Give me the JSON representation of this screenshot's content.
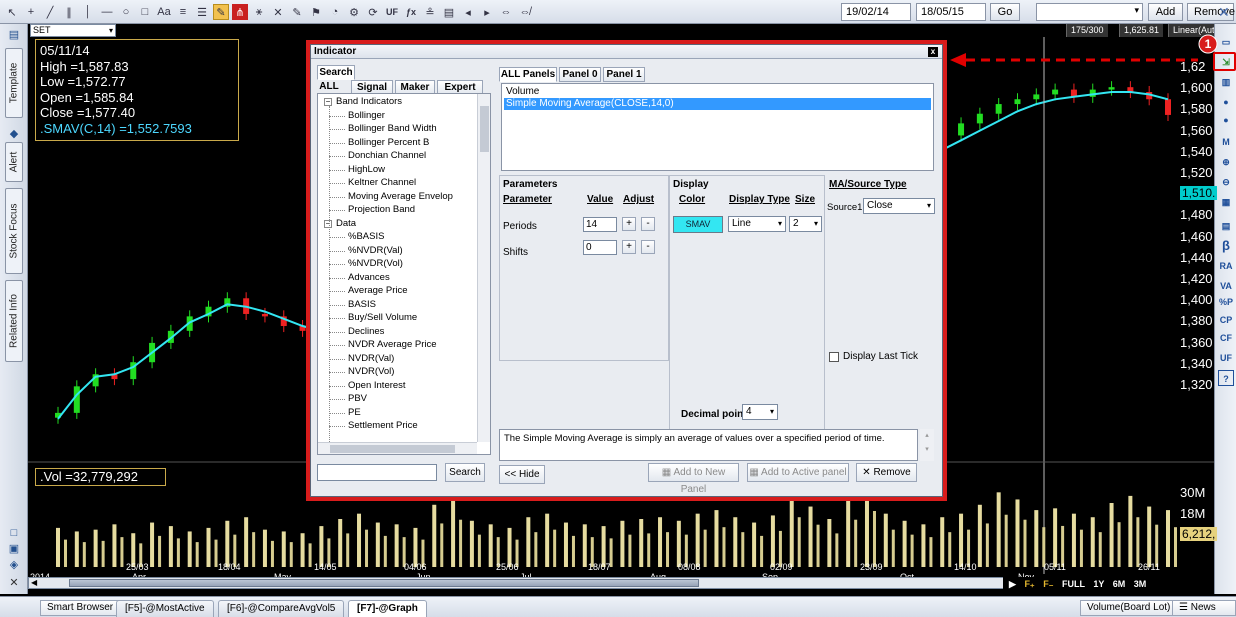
{
  "toolbar": {
    "icons": [
      "cursor-icon",
      "crosshair-icon",
      "line-icon",
      "parallel-line-icon",
      "vertical-line-icon",
      "horizontal-line-icon",
      "circle-icon",
      "rectangle-icon",
      "text-icon",
      "fibonacci-icon",
      "lines-menu-icon",
      "pencil-icon",
      "pitchfork-icon",
      "gann-icon",
      "delete-icon",
      "marker-icon",
      "bookmark-icon",
      "indicator-icon",
      "settings-icon",
      "refresh-icon",
      "uf-icon",
      "formula-icon",
      "scale-icon",
      "save-icon",
      "arrow-left-icon",
      "arrow-right-icon",
      "zoom-in-icon",
      "zoom-out-icon"
    ],
    "uf_label": "UF",
    "fx_label": "f(x)",
    "date_from": "19/02/14",
    "date_to": "18/05/15",
    "go_label": "Go",
    "add_label": "Add",
    "remove_label": "Remove",
    "close_glyph": "✕"
  },
  "symbol_bar": {
    "symbol": "SET",
    "count": "175/300",
    "last_price": "1,625.81",
    "scale_mode": "Linear(Auto"
  },
  "left_tabs": [
    "Template",
    "Alert",
    "Stock Focus",
    "Related Info"
  ],
  "right_icons": [
    "panel-icon",
    "indicator-list-icon",
    "chart-icon",
    "add-icon",
    "remove-icon",
    "ma-icon",
    "zoom-in-icon",
    "zoom-out-icon",
    "grid-icon",
    "calendar-icon",
    "beta-icon",
    "ra-icon",
    "va-icon",
    "p-percent-icon",
    "cp-icon",
    "cf-icon",
    "uf-icon",
    "help-icon"
  ],
  "right_icon_labels": {
    "beta": "β",
    "ra": "RA",
    "va": "VA",
    "pp": "%P",
    "cp": "CP",
    "cf": "CF",
    "uf": "UF",
    "help": "?"
  },
  "callout_number": "1",
  "ohlc": {
    "date": "05/11/14",
    "high": "High =1,587.83",
    "low": "Low =1,572.77",
    "open": "Open =1,585.84",
    "close": "Close =1,577.40",
    "smav": ".SMAV(C,14)  =1,552.7593"
  },
  "volume_readout": ".Vol  =32,779,292",
  "price_axis": [
    "1,62",
    "1,600",
    "1,580",
    "1,560",
    "1,540",
    "1,520",
    "1,510.",
    "1,480",
    "1,460",
    "1,440",
    "1,420",
    "1,400",
    "1,380",
    "1,360",
    "1,340",
    "1,320"
  ],
  "volume_axis": [
    "30M",
    "18M",
    "6,212,"
  ],
  "date_axis": {
    "days": [
      "25/03",
      "18/04",
      "14/05",
      "04/06",
      "25/06",
      "18/07",
      "08/08",
      "02/09",
      "23/09",
      "14/10",
      "05/11",
      "26/11"
    ],
    "months": [
      "2014",
      "Apr",
      "May",
      "Jun",
      "Jul",
      "Aug",
      "Sep",
      "Oct",
      "Nov"
    ]
  },
  "period_bar": [
    "F₊",
    "F₋",
    "FULL",
    "1Y",
    "6M",
    "3M"
  ],
  "chart_data": {
    "type": "line",
    "series": [
      {
        "name": ".SMAV(C,14)",
        "values": [
          1325,
          1345,
          1360,
          1362,
          1368,
          1380,
          1392,
          1405,
          1412,
          1420,
          1418,
          1414,
          1408,
          1402,
          1398,
          1396,
          1400,
          1412,
          1428,
          1442,
          1455,
          1468,
          1482,
          1495,
          1505,
          1512,
          1515,
          1520,
          1524,
          1528,
          1530,
          1532,
          1534,
          1535,
          1538,
          1542,
          1546,
          1550,
          1554,
          1560,
          1562,
          1564,
          1562,
          1560,
          1552,
          1546,
          1544,
          1548,
          1556,
          1564,
          1572,
          1580,
          1586,
          1590,
          1592,
          1594,
          1596,
          1596,
          1594,
          1590
        ]
      },
      {
        "name": "Close",
        "values": [
          1330,
          1352,
          1362,
          1358,
          1372,
          1388,
          1398,
          1410,
          1418,
          1425,
          1412,
          1410,
          1402,
          1398,
          1392,
          1398,
          1408,
          1420,
          1440,
          1450,
          1462,
          1475,
          1488,
          1500,
          1508,
          1514,
          1518,
          1522,
          1526,
          1530,
          1528,
          1536,
          1532,
          1538,
          1540,
          1546,
          1550,
          1556,
          1560,
          1566,
          1568,
          1562,
          1556,
          1546,
          1530,
          1538,
          1550,
          1560,
          1570,
          1578,
          1586,
          1590,
          1594,
          1598,
          1592,
          1598,
          1600,
          1596,
          1590,
          1577
        ]
      }
    ],
    "volume": [
      22,
      20,
      21,
      24,
      19,
      25,
      23,
      20,
      22,
      26,
      28,
      21,
      20,
      19,
      23,
      27,
      30,
      25,
      24,
      22,
      35,
      38,
      26,
      24,
      22,
      28,
      30,
      25,
      24,
      23,
      26,
      27,
      28,
      26,
      30,
      32,
      28,
      25,
      29,
      40,
      34,
      27,
      38,
      45,
      30,
      26,
      24,
      28,
      30,
      35,
      42,
      38,
      32,
      33,
      30,
      28,
      36,
      40,
      34,
      32
    ],
    "ylabel": "",
    "ylim": [
      1310,
      1630
    ]
  },
  "dialog": {
    "title": "Indicator",
    "close_glyph": "x",
    "search_tab": "Search",
    "tabs": [
      "ALL",
      "Signal",
      "Maker",
      "Expert"
    ],
    "panel_tabs": [
      "ALL Panels",
      "Panel 0",
      "Panel 1"
    ],
    "tree": [
      {
        "label": "Band Indicators",
        "group": true
      },
      {
        "label": "Bollinger"
      },
      {
        "label": "Bollinger Band Width"
      },
      {
        "label": "Bollinger Percent B"
      },
      {
        "label": "Donchian Channel"
      },
      {
        "label": "HighLow"
      },
      {
        "label": "Keltner Channel"
      },
      {
        "label": "Moving Average Envelop"
      },
      {
        "label": "Projection Band"
      },
      {
        "label": "Data",
        "group": true
      },
      {
        "label": "%BASIS"
      },
      {
        "label": "%NVDR(Val)"
      },
      {
        "label": "%NVDR(Vol)"
      },
      {
        "label": "Advances"
      },
      {
        "label": "Average Price"
      },
      {
        "label": "BASIS"
      },
      {
        "label": "Buy/Sell Volume"
      },
      {
        "label": "Declines"
      },
      {
        "label": "NVDR Average Price"
      },
      {
        "label": "NVDR(Val)"
      },
      {
        "label": "NVDR(Vol)"
      },
      {
        "label": "Open Interest"
      },
      {
        "label": "PBV"
      },
      {
        "label": "PE"
      },
      {
        "label": "Settlement Price"
      }
    ],
    "active_list": [
      "Volume",
      "Simple Moving Average(CLOSE,14,0)"
    ],
    "parameters": {
      "title": "Parameters",
      "col_param": "Parameter",
      "col_value": "Value",
      "col_adjust": "Adjust",
      "rows": [
        {
          "name": "Periods",
          "value": "14"
        },
        {
          "name": "Shifts",
          "value": "0"
        }
      ],
      "plus": "+",
      "minus": "-"
    },
    "display": {
      "title": "Display",
      "col_color": "Color",
      "col_type": "Display Type",
      "col_size": "Size",
      "color_label": "SMAV",
      "color_hex": "#33e6f2",
      "type_value": "Line",
      "size_value": "2",
      "decimal_label": "Decimal point",
      "decimal_value": "4"
    },
    "ma_source": {
      "title": "MA/Source Type",
      "source_label": "Source1",
      "source_value": "Close",
      "last_tick_label": "Display Last Tick"
    },
    "description": "The Simple Moving Average is simply an average of values over a specified period of time.",
    "search_placeholder": "",
    "search_btn": "Search",
    "hide_btn": "<< Hide",
    "add_new_panel": "Add to New Panel",
    "add_active_panel": "Add to Active panel",
    "remove_btn": "Remove",
    "remove_glyph": "✕"
  },
  "statusbar": {
    "smart_browser": "Smart Browser",
    "tabs": [
      "[F5]-@MostActive",
      "[F6]-@CompareAvgVol5",
      "[F7]-@Graph"
    ],
    "volume_mode": "Volume(Board Lot)",
    "news_bar": "News Bar"
  }
}
